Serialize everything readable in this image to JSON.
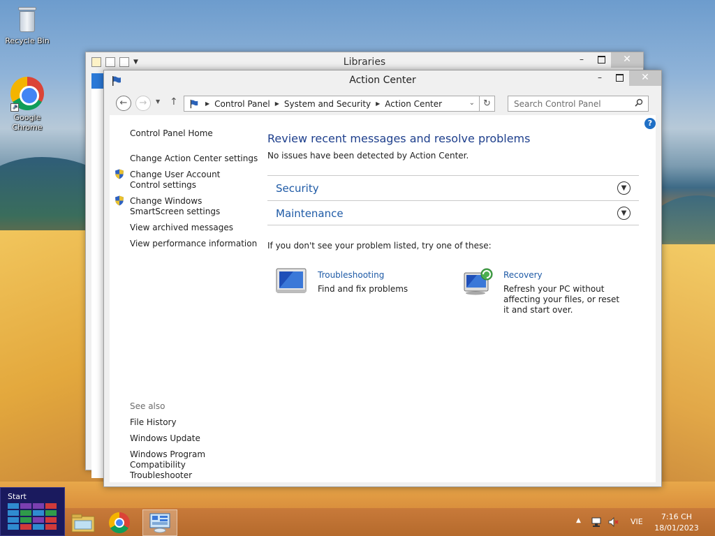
{
  "desktop": {
    "icons": [
      {
        "label": "Recycle Bin",
        "icon": "recycle-bin-icon"
      },
      {
        "label": "Google Chrome",
        "icon": "chrome-icon"
      }
    ]
  },
  "back_window": {
    "title": "Libraries",
    "caption": {
      "minimize": "–",
      "close": "✕"
    }
  },
  "window": {
    "title": "Action Center",
    "caption": {
      "minimize": "–",
      "close": "✕"
    },
    "nav": {
      "back": "←",
      "forward": "→",
      "up": "↑",
      "refresh": "↻"
    },
    "breadcrumb": [
      "Control Panel",
      "System and Security",
      "Action Center"
    ],
    "search": {
      "placeholder": "Search Control Panel"
    },
    "help": "?"
  },
  "sidebar": {
    "home": "Control Panel Home",
    "links": [
      "Change Action Center settings",
      "Change User Account Control settings",
      "Change Windows SmartScreen settings",
      "View archived messages",
      "View performance information"
    ],
    "see_also": {
      "heading": "See also",
      "links": [
        "File History",
        "Windows Update",
        "Windows Program Compatibility Troubleshooter"
      ]
    }
  },
  "main": {
    "heading": "Review recent messages and resolve problems",
    "status": "No issues have been detected by Action Center.",
    "sections": [
      {
        "label": "Security"
      },
      {
        "label": "Maintenance"
      }
    ],
    "hint": "If you don't see your problem listed, try one of these:",
    "tools": [
      {
        "name": "Troubleshooting",
        "desc": "Find and fix problems"
      },
      {
        "name": "Recovery",
        "desc": "Refresh your PC without affecting your files, or reset it and start over."
      }
    ]
  },
  "taskbar": {
    "start": "Start",
    "language": "VIE",
    "time": "7:16 CH",
    "date": "18/01/2023"
  },
  "colors": {
    "link": "#1e5aa6",
    "heading": "#1e3f8c",
    "close_button": "#c7c7c7"
  }
}
